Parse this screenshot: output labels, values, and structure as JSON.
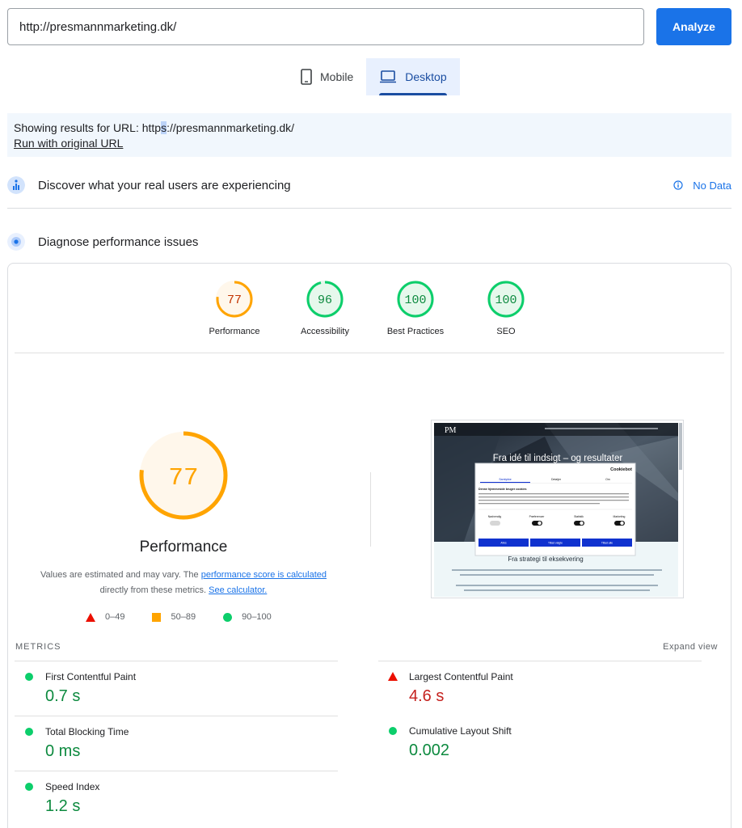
{
  "url_bar": {
    "value": "http://presmannmarketing.dk/",
    "analyze_label": "Analyze"
  },
  "device_tabs": {
    "mobile": "Mobile",
    "desktop": "Desktop",
    "active": "desktop"
  },
  "notice": {
    "prefix": "Showing results for URL: http",
    "highlight": "s",
    "suffix": "://presmannmarketing.dk/",
    "link": "Run with original URL"
  },
  "field_data": {
    "title": "Discover what your real users are experiencing",
    "status": "No Data"
  },
  "lab_data": {
    "title": "Diagnose performance issues"
  },
  "scores": [
    {
      "label": "Performance",
      "value": "77",
      "score": 0.77,
      "color": "#ffa400"
    },
    {
      "label": "Accessibility",
      "value": "96",
      "score": 0.96,
      "color": "#0cce6b"
    },
    {
      "label": "Best Practices",
      "value": "100",
      "score": 1.0,
      "color": "#0cce6b"
    },
    {
      "label": "SEO",
      "value": "100",
      "score": 1.0,
      "color": "#0cce6b"
    }
  ],
  "performance": {
    "value": "77",
    "score": 0.77,
    "title": "Performance",
    "desc_1": "Values are estimated and may vary. The ",
    "desc_link_1": "performance score is calculated",
    "desc_2": " directly from these metrics. ",
    "desc_link_2": "See calculator."
  },
  "legend": {
    "fail": "0–49",
    "average": "50–89",
    "pass": "90–100"
  },
  "screenshot": {
    "logo": "PM",
    "headline": "Fra idé til indsigt – og resultater",
    "subheadline": "Fra strategi til eksekvering",
    "cookie_brand": "Cookiebot",
    "cookie_tabs": [
      "Samtykke",
      "Detaljer",
      "Om"
    ],
    "cookie_title": "Denne hjemmeside bruger cookies",
    "cookie_categories": [
      "Nødvendig",
      "Præferencer",
      "Statistik",
      "Marketing"
    ],
    "cookie_buttons": [
      "Afvis",
      "Tillad valgte",
      "Tillad alle"
    ]
  },
  "metrics": {
    "header": "METRICS",
    "expand": "Expand view",
    "fcp": {
      "name": "First Contentful Paint",
      "value": "0.7 s",
      "status": "pass"
    },
    "lcp": {
      "name": "Largest Contentful Paint",
      "value": "4.6 s",
      "status": "fail"
    },
    "tbt": {
      "name": "Total Blocking Time",
      "value": "0 ms",
      "status": "pass"
    },
    "cls": {
      "name": "Cumulative Layout Shift",
      "value": "0.002",
      "status": "pass"
    },
    "si": {
      "name": "Speed Index",
      "value": "1.2 s",
      "status": "pass"
    }
  },
  "colors": {
    "accent": "#1a73e8",
    "pass": "#0cce6b",
    "average": "#ffa400",
    "fail": "#eb0f00"
  }
}
